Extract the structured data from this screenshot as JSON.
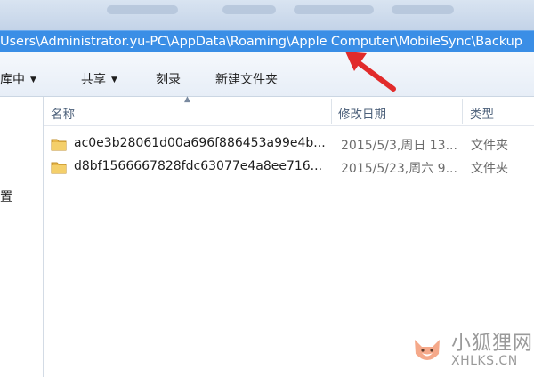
{
  "address": {
    "path": "Users\\Administrator.yu-PC\\AppData\\Roaming\\Apple Computer\\MobileSync\\Backup"
  },
  "toolbar": {
    "library_label": "库中",
    "share_label": "共享",
    "burn_label": "刻录",
    "new_folder_label": "新建文件夹"
  },
  "nav": {
    "partial_label": "置"
  },
  "columns": {
    "name": "名称",
    "modified": "修改日期",
    "type": "类型"
  },
  "files": [
    {
      "name": "ac0e3b28061d00a696f886453a99e4b...",
      "modified": "2015/5/3,周日 13...",
      "type": "文件夹"
    },
    {
      "name": "d8bf1566667828fdc63077e4a8ee716...",
      "modified": "2015/5/23,周六 9...",
      "type": "文件夹"
    }
  ],
  "watermark": {
    "cn": "小狐狸网",
    "en": "XHLKS.CN"
  },
  "colors": {
    "address_bar": "#3a8ee6",
    "annotation_arrow": "#e12b2b",
    "folder": "#e8b84a"
  },
  "icons": [
    "folder-icon",
    "chevron-down-icon",
    "sort-up-icon",
    "annotation-arrow",
    "fox-logo"
  ]
}
